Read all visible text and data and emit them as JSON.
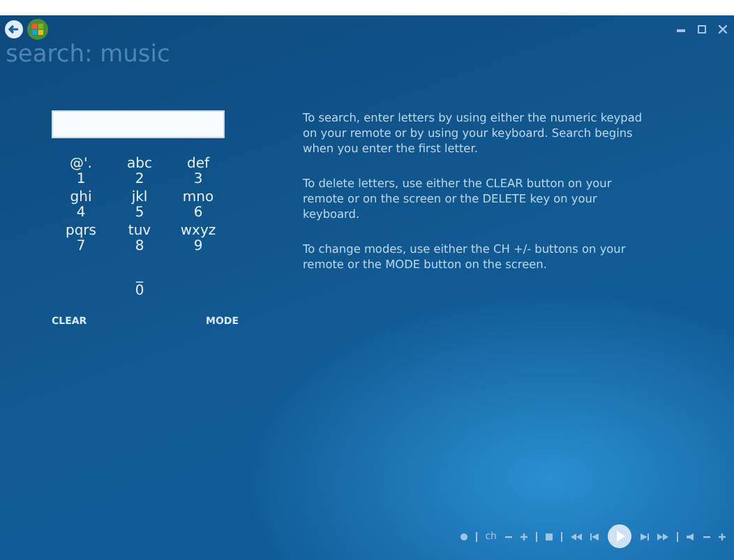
{
  "title": "search: music",
  "keys": [
    {
      "letters": "@'.",
      "digit": "1"
    },
    {
      "letters": "abc",
      "digit": "2"
    },
    {
      "letters": "def",
      "digit": "3"
    },
    {
      "letters": "ghi",
      "digit": "4"
    },
    {
      "letters": "jkl",
      "digit": "5"
    },
    {
      "letters": "mno",
      "digit": "6"
    },
    {
      "letters": "pqrs",
      "digit": "7"
    },
    {
      "letters": "tuv",
      "digit": "8"
    },
    {
      "letters": "wxyz",
      "digit": "9"
    },
    {
      "letters": "_",
      "digit": "0"
    }
  ],
  "buttons": [
    "CLEAR",
    "MODE"
  ],
  "instructions": [
    "To search, enter letters by using either the numeric keypad on your remote or by using your keyboard. Search begins when you enter the first letter.",
    "To delete letters, use either the CLEAR button on your remote or on the screen or the DELETE key on your keyboard.",
    "To change modes, use either the CH +/- buttons on your remote or the MODE button on the screen."
  ],
  "transport": {
    "channel_label": "ch"
  }
}
